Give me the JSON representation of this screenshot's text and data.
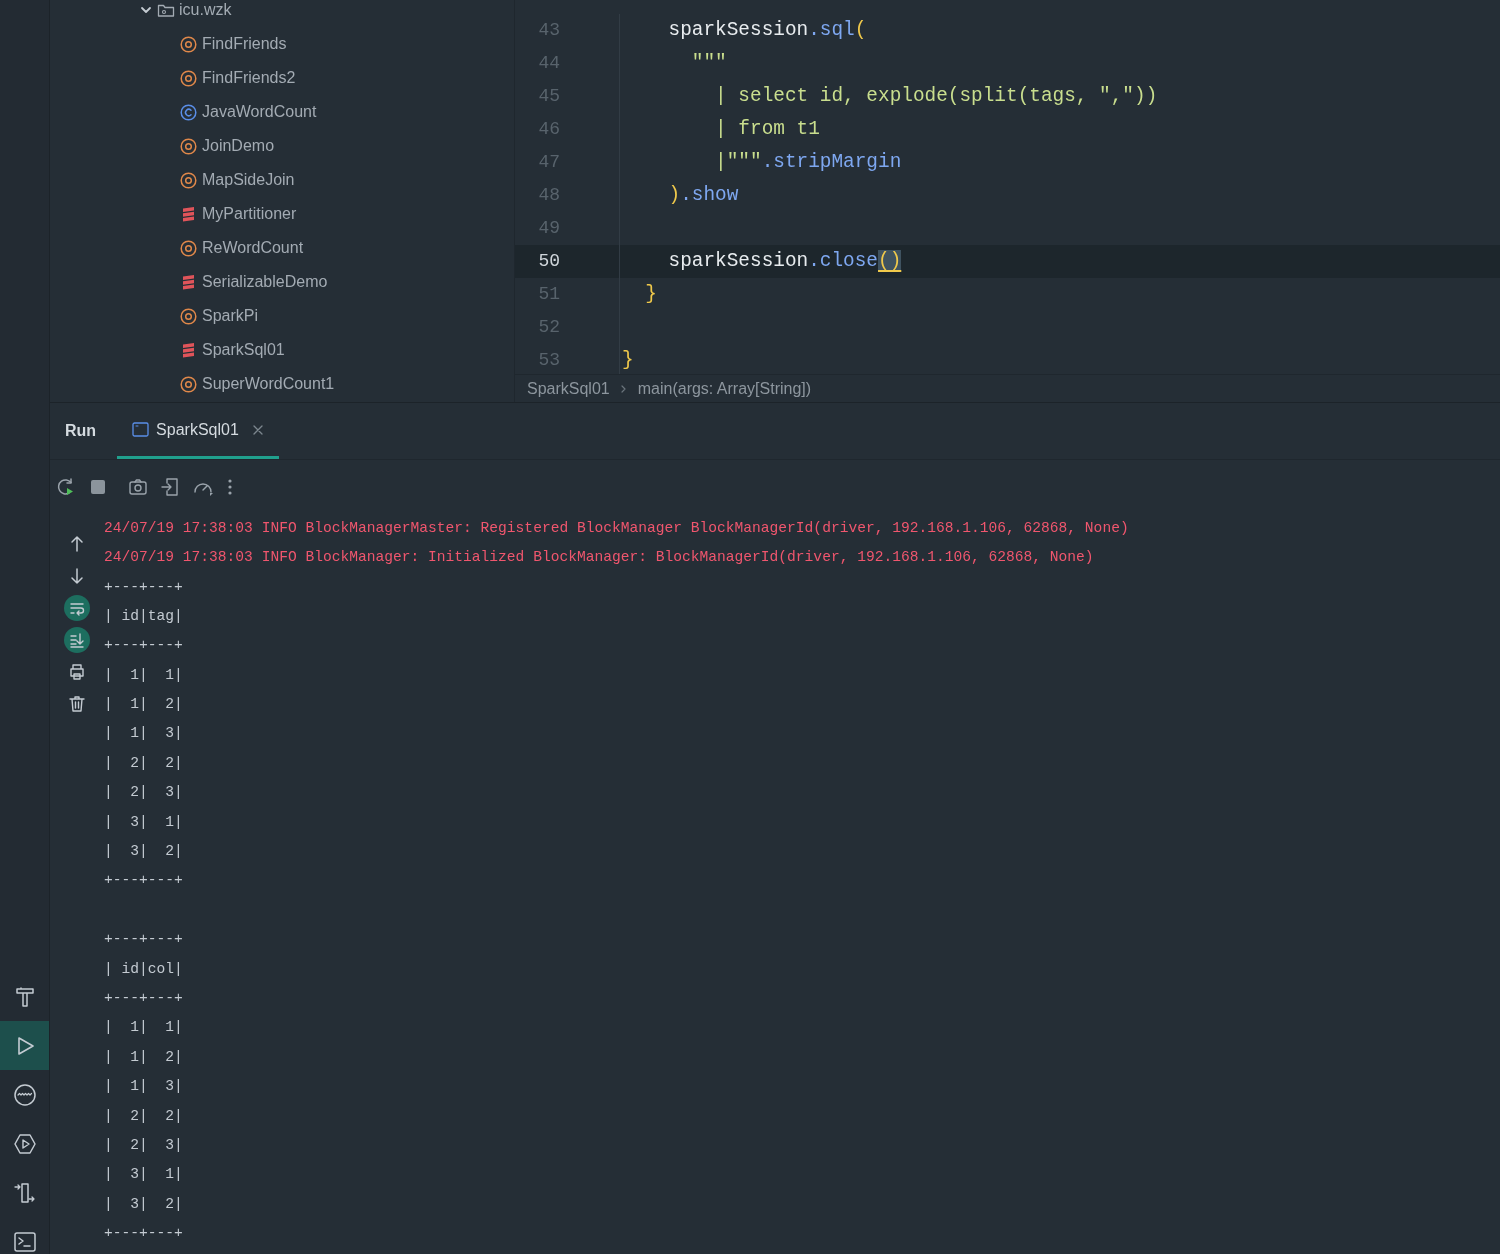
{
  "project_tree": {
    "folder": {
      "label": "icu.wzk",
      "expanded": true,
      "children": [
        {
          "label": "FindFriends",
          "kind": "object"
        },
        {
          "label": "FindFriends2",
          "kind": "object"
        },
        {
          "label": "JavaWordCount",
          "kind": "class"
        },
        {
          "label": "JoinDemo",
          "kind": "object"
        },
        {
          "label": "MapSideJoin",
          "kind": "object"
        },
        {
          "label": "MyPartitioner",
          "kind": "scala-file"
        },
        {
          "label": "ReWordCount",
          "kind": "object"
        },
        {
          "label": "SerializableDemo",
          "kind": "scala-file"
        },
        {
          "label": "SparkPi",
          "kind": "object"
        },
        {
          "label": "SparkSql01",
          "kind": "scala-file"
        },
        {
          "label": "SuperWordCount1",
          "kind": "object"
        }
      ]
    }
  },
  "editor": {
    "lines": [
      {
        "number": "43",
        "selected": false,
        "tokens": [
          {
            "text": "    sparkSession",
            "kind": "plain"
          },
          {
            "text": ".sql",
            "kind": "method"
          },
          {
            "text": "(",
            "kind": "paren"
          }
        ]
      },
      {
        "number": "44",
        "selected": false,
        "tokens": [
          {
            "text": "      \"\"\"",
            "kind": "string"
          }
        ]
      },
      {
        "number": "45",
        "selected": false,
        "tokens": [
          {
            "text": "        | select id, explode(split(tags, \",\"))",
            "kind": "string"
          }
        ]
      },
      {
        "number": "46",
        "selected": false,
        "tokens": [
          {
            "text": "        | from t1",
            "kind": "string"
          }
        ]
      },
      {
        "number": "47",
        "selected": false,
        "tokens": [
          {
            "text": "        |\"\"\"",
            "kind": "string"
          },
          {
            "text": ".stripMargin",
            "kind": "method"
          }
        ]
      },
      {
        "number": "48",
        "selected": false,
        "tokens": [
          {
            "text": "    )",
            "kind": "paren"
          },
          {
            "text": ".show",
            "kind": "method"
          }
        ]
      },
      {
        "number": "49",
        "selected": false
      },
      {
        "number": "50",
        "selected": true,
        "tokens": [
          {
            "text": "    sparkSession",
            "kind": "plain"
          },
          {
            "text": ".close",
            "kind": "method"
          },
          {
            "text": "()",
            "kind": "matched-brace"
          }
        ]
      },
      {
        "number": "51",
        "selected": false,
        "tokens": [
          {
            "text": "  }",
            "kind": "paren"
          }
        ]
      },
      {
        "number": "52",
        "selected": false
      },
      {
        "number": "53",
        "selected": false,
        "tokens": [
          {
            "text": "}",
            "kind": "paren"
          }
        ]
      }
    ],
    "breadcrumb": [
      "SparkSql01",
      "main(args: Array[String])"
    ]
  },
  "run_panel": {
    "title": "Run",
    "tabs": [
      {
        "label": "SparkSql01",
        "selected": true
      }
    ],
    "side_toggles": [
      {
        "kind": "up",
        "on": false
      },
      {
        "kind": "down",
        "on": false
      },
      {
        "kind": "wrap",
        "on": true
      },
      {
        "kind": "scroll-end",
        "on": true
      },
      {
        "kind": "print",
        "on": false
      },
      {
        "kind": "trash",
        "on": false
      }
    ],
    "console": [
      {
        "text": "24/07/19 17:38:03 INFO BlockManagerMaster: Registered BlockManager BlockManagerId(driver, 192.168.1.106, 62868, None)",
        "kind": "log"
      },
      {
        "text": "24/07/19 17:38:03 INFO BlockManager: Initialized BlockManager: BlockManagerId(driver, 192.168.1.106, 62868, None)",
        "kind": "log"
      },
      {
        "text": "+---+---+",
        "kind": "output"
      },
      {
        "text": "| id|tag|",
        "kind": "output"
      },
      {
        "text": "+---+---+",
        "kind": "output"
      },
      {
        "text": "|  1|  1|",
        "kind": "output"
      },
      {
        "text": "|  1|  2|",
        "kind": "output"
      },
      {
        "text": "|  1|  3|",
        "kind": "output"
      },
      {
        "text": "|  2|  2|",
        "kind": "output"
      },
      {
        "text": "|  2|  3|",
        "kind": "output"
      },
      {
        "text": "|  3|  1|",
        "kind": "output"
      },
      {
        "text": "|  3|  2|",
        "kind": "output"
      },
      {
        "text": "+---+---+",
        "kind": "output"
      },
      {
        "kind": "blank"
      },
      {
        "text": "+---+---+",
        "kind": "output"
      },
      {
        "text": "| id|col|",
        "kind": "output"
      },
      {
        "text": "+---+---+",
        "kind": "output"
      },
      {
        "text": "|  1|  1|",
        "kind": "output"
      },
      {
        "text": "|  1|  2|",
        "kind": "output"
      },
      {
        "text": "|  1|  3|",
        "kind": "output"
      },
      {
        "text": "|  2|  2|",
        "kind": "output"
      },
      {
        "text": "|  2|  3|",
        "kind": "output"
      },
      {
        "text": "|  3|  1|",
        "kind": "output"
      },
      {
        "text": "|  3|  2|",
        "kind": "output"
      },
      {
        "text": "+---+---+",
        "kind": "output"
      }
    ]
  },
  "tool_strip": [
    {
      "kind": "build",
      "selected": false
    },
    {
      "kind": "run",
      "selected": true
    },
    {
      "kind": "profiler",
      "selected": false
    },
    {
      "kind": "services",
      "selected": false
    },
    {
      "kind": "git",
      "selected": false
    },
    {
      "kind": "terminal",
      "selected": false
    }
  ]
}
